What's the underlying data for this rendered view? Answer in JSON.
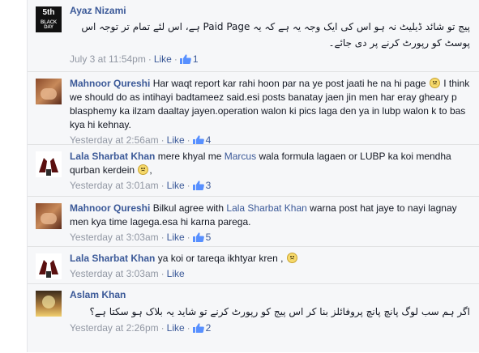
{
  "comments": [
    {
      "author": "Ayaz Nizami",
      "avatar_text": [
        "5th",
        "BLACK DAY"
      ],
      "text_rtl": "پیج تو شائد ڈیلیٹ نہ ہو اس کی ایک وجہ یہ ہے کہ یہ Paid Page ہے، اس لئے تمام تر توجہ اس پوسٹ کو رپورٹ کرنے پر دی جائے۔",
      "time": "July 3 at 11:54pm",
      "action": "Like",
      "likes": "1"
    },
    {
      "author": "Mahnoor Qureshi",
      "text_a": "Har waqt report kar rahi hoon par na ye post jaati he na hi page",
      "text_b": "I think we should do as intihayi badtameez said.esi posts banatay jaen jin men har eray gheary p blasphemy ka ilzam daaltay jayen.operation walon ki pics laga den ya in lubp walon k to bas kya hi kehnay.",
      "time": "Yesterday at 2:56am",
      "action": "Like",
      "likes": "4"
    },
    {
      "author": "Lala Sharbat Khan",
      "text_a": "mere khyal me",
      "mention": "Marcus",
      "text_b": "wala formula lagaen or LUBP ka koi mendha qurban kerdein",
      "text_c": ",",
      "time": "Yesterday at 3:01am",
      "action": "Like",
      "likes": "3"
    },
    {
      "author": "Mahnoor Qureshi",
      "text_a": "Bilkul agree with",
      "mention": "Lala Sharbat Khan",
      "text_b": "warna post hat jaye to nayi lagnay men kya time lagega.esa hi karna parega.",
      "time": "Yesterday at 3:03am",
      "action": "Like",
      "likes": "5"
    },
    {
      "author": "Lala Sharbat Khan",
      "text_a": "ya koi or tareqa ikhtyar kren ,",
      "time": "Yesterday at 3:03am",
      "action": "Like"
    },
    {
      "author": "Aslam Khan",
      "text_rtl": "اگر ہم سب لوگ پانچ پانچ پروفائلز بنا کر اس پیج کو رپورٹ کرنے تو شاید یہ بلاک ہو سکتا ہے؟",
      "time": "Yesterday at 2:26pm",
      "action": "Like",
      "likes": "2"
    }
  ],
  "icons": {
    "thumb": "like-thumb-icon",
    "emoji": "frown-emoticon-icon"
  },
  "colors": {
    "link": "#3b5998",
    "meta": "#9197a3",
    "background": "#f6f7f9"
  }
}
